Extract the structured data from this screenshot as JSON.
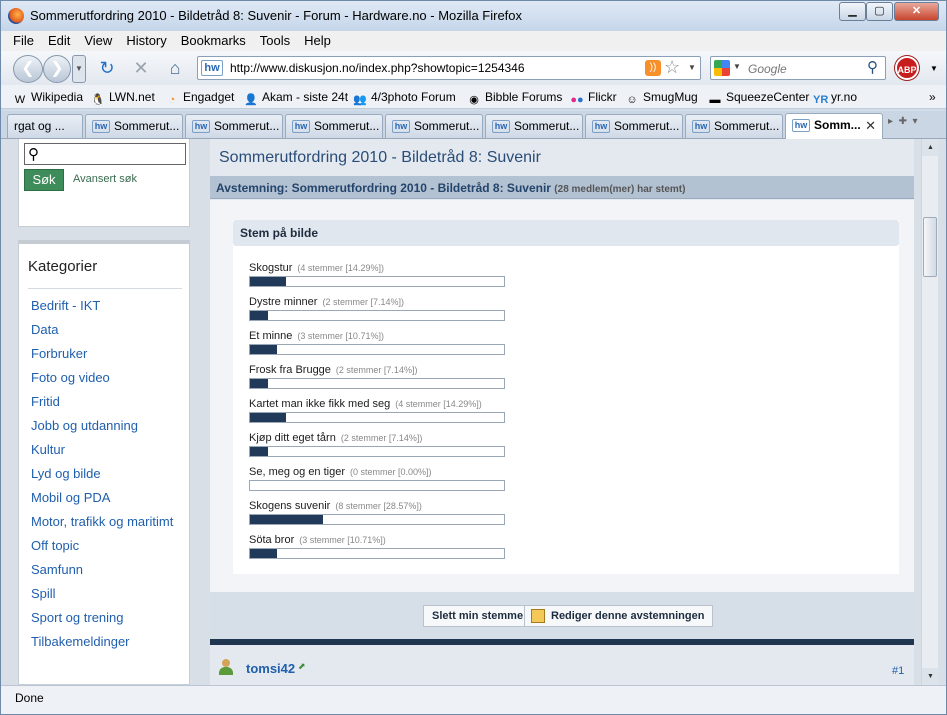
{
  "window": {
    "title": "Sommerutfordring 2010 - Bildetråd 8: Suvenir - Forum - Hardware.no - Mozilla Firefox"
  },
  "menu": [
    "File",
    "Edit",
    "View",
    "History",
    "Bookmarks",
    "Tools",
    "Help"
  ],
  "nav": {
    "url": "http://www.diskusjon.no/index.php?showtopic=1254346",
    "search_placeholder": "Google"
  },
  "bookmarks": [
    "Wikipedia",
    "LWN.net",
    "Engadget",
    "Akam - siste 24t",
    "4/3photo Forum",
    "Bibble Forums",
    "Flickr",
    "SmugMug",
    "SqueezeCenter",
    "yr.no"
  ],
  "tabs": [
    "rgat og ...",
    "Sommerut...",
    "Sommerut...",
    "Sommerut...",
    "Sommerut...",
    "Sommerut...",
    "Sommerut...",
    "Sommerut...",
    "Somm..."
  ],
  "sidebar": {
    "search_button": "Søk",
    "advanced": "Avansert søk",
    "categories_title": "Kategorier",
    "categories": [
      "Bedrift - IKT",
      "Data",
      "Forbruker",
      "Foto og video",
      "Fritid",
      "Jobb og utdanning",
      "Kultur",
      "Lyd og bilde",
      "Mobil og PDA",
      "Motor, trafikk og maritimt",
      "Off topic",
      "Samfunn",
      "Spill",
      "Sport og trening",
      "Tilbakemeldinger"
    ]
  },
  "main": {
    "page_title": "Sommerutfordring 2010 - Bildetråd 8: Suvenir",
    "poll_heading": "Avstemning: Sommerutfordring 2010 - Bildetråd 8: Suvenir",
    "poll_count": "(28 medlem(mer) har stemt)",
    "vote_header": "Stem på bilde",
    "options": [
      {
        "label": "Skogstur",
        "votes": "(4 stemmer [14.29%])",
        "pct": 14.29
      },
      {
        "label": "Dystre minner",
        "votes": "(2 stemmer [7.14%])",
        "pct": 7.14
      },
      {
        "label": "Et minne",
        "votes": "(3 stemmer [10.71%])",
        "pct": 10.71
      },
      {
        "label": "Frosk fra Brugge",
        "votes": "(2 stemmer [7.14%])",
        "pct": 7.14
      },
      {
        "label": "Kartet man ikke fikk med seg",
        "votes": "(4 stemmer [14.29%])",
        "pct": 14.29
      },
      {
        "label": "Kjøp ditt eget tårn",
        "votes": "(2 stemmer [7.14%])",
        "pct": 7.14
      },
      {
        "label": "Se, meg og en tiger",
        "votes": "(0 stemmer [0.00%])",
        "pct": 0
      },
      {
        "label": "Skogens suvenir",
        "votes": "(8 stemmer [28.57%])",
        "pct": 28.57
      },
      {
        "label": "Söta bror",
        "votes": "(3 stemmer [10.71%])",
        "pct": 10.71
      }
    ],
    "delete_vote": "Slett min stemme",
    "edit_poll": "Rediger denne avstemningen",
    "post_user": "tomsi42",
    "post_number": "#1"
  },
  "status": "Done",
  "colors": {
    "bar_fill": "#223a59",
    "link": "#1f5fae",
    "search_button": "#3e8c5a"
  }
}
